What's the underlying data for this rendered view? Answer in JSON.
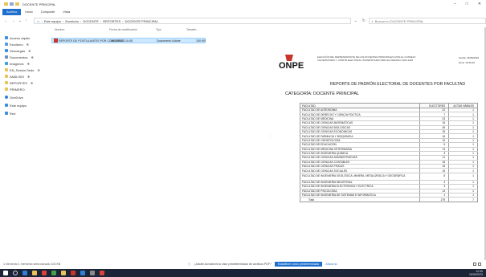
{
  "window": {
    "title": "DOCENTE PRINCIPAL",
    "controls": [
      "–",
      "□",
      "✕"
    ]
  },
  "ribbon": {
    "tabs": [
      "Archivo",
      "Inicio",
      "Compartir",
      "Vista"
    ]
  },
  "address": {
    "crumbs": [
      "Este equipo",
      "Escritorio",
      "DOCENTE",
      "REPORTES",
      "DOCENTE PRINCIPAL"
    ],
    "search_placeholder": "Buscar en DOCENTE PRINCIPAL"
  },
  "sidebar": {
    "items": [
      {
        "label": "Acceso rápido",
        "color": "#3b8fe0",
        "pinned": false
      },
      {
        "label": "Escritorio",
        "color": "#4f9be6",
        "pinned": true
      },
      {
        "label": "Descargas",
        "color": "#3b8fe0",
        "pinned": true
      },
      {
        "label": "Documentos",
        "color": "#6a8fb8",
        "pinned": true
      },
      {
        "label": "Imágenes",
        "color": "#3f9fd8",
        "pinned": true
      },
      {
        "label": "EN_Sesión Sede",
        "color": "#e8c45a",
        "pinned": true
      },
      {
        "label": "ANÁLISIS",
        "color": "#e8c45a",
        "pinned": true
      },
      {
        "label": "REPORTES",
        "color": "#e8c45a",
        "pinned": true
      },
      {
        "label": "PRIMERO",
        "color": "#e8c45a",
        "pinned": false
      },
      {
        "label": "OneDrive",
        "color": "#2f7fd6",
        "pinned": false
      },
      {
        "label": "Este equipo",
        "color": "#3b8fe0",
        "pinned": false,
        "active": true
      },
      {
        "label": "Red",
        "color": "#3b8fe0",
        "pinned": false
      }
    ]
  },
  "filelist": {
    "columns": [
      "Nombre",
      "Fecha de modificación",
      "Tipo",
      "Tamaño"
    ],
    "files": [
      {
        "name": "REPORTE DE POSTULANTES POR CONCURSO",
        "date": "15/05/2023 10:45",
        "type": "Documento Adobe",
        "size": "100 KB"
      }
    ]
  },
  "preview": {
    "logo_text": "ONPE",
    "header_lines": [
      "ELECCIÓN DEL REPRESENTANTE DE LOS DOCENTES PRINCIPALES ANTE EL CONSEJO",
      "UNIVERSITARIO Y COMITÉ ELECTORAL UNIVERSITARIO PARA EL PERIODO 2023-2025"
    ],
    "meta": [
      {
        "label": "Fecha:",
        "value": "15/05/2023"
      },
      {
        "label": "Hora:",
        "value": "10:45:45"
      }
    ],
    "report_title": "REPORTE DE PADRÓN ELECTORAL DE DOCENTES POR FACULTAD",
    "category": "CATEGORÍA: DOCENTE PRINCIPAL",
    "table": {
      "headers": [
        "FACULTAD",
        "ELECTORES",
        "ACTAS HÁBILES"
      ],
      "rows": [
        [
          "FACULTAD DE AGRONOMÍA",
          "22",
          "1"
        ],
        [
          "FACULTAD DE DERECHO Y CIENCIA POLÍTICA",
          "7",
          "1"
        ],
        [
          "FACULTAD DE MEDICINA",
          "23",
          "1"
        ],
        [
          "FACULTAD DE CIENCIAS MATEMÁTICAS",
          "15",
          "1"
        ],
        [
          "FACULTAD DE CIENCIAS BIOLÓGICAS",
          "45",
          "1"
        ],
        [
          "FACULTAD DE CIENCIAS ECONÓMICAS",
          "15",
          "1"
        ],
        [
          "FACULTAD DE FARMACIA Y BIOQUÍMICA",
          "16",
          "1"
        ],
        [
          "FACULTAD DE ODONTOLOGÍA",
          "10",
          "1"
        ],
        [
          "FACULTAD DE EDUCACIÓN",
          "5",
          "1"
        ],
        [
          "FACULTAD DE MEDICINA VETERINARIA",
          "13",
          "1"
        ],
        [
          "FACULTAD DE INGENIERÍA QUÍMICA",
          "3",
          "1"
        ],
        [
          "FACULTAD DE CIENCIAS ADMINISTRATIVAS",
          "11",
          "1"
        ],
        [
          "FACULTAD DE CIENCIAS CONTABLES",
          "18",
          "1"
        ],
        [
          "FACULTAD DE CIENCIAS FÍSICAS",
          "16",
          "1"
        ],
        [
          "FACULTAD DE CIENCIAS SOCIALES",
          "15",
          "1"
        ],
        [
          "FACULTAD DE INGENIERÍA GEOLÓGICA, MINERA, METALÚRGICA Y GEOGRÁFICA",
          "8",
          "1"
        ],
        [
          "FACULTAD DE INGENIERÍA INDUSTRIAL",
          "3",
          "1"
        ],
        [
          "FACULTAD DE INGENIERÍA ELECTRÓNICA Y ELÉCTRICA",
          "3",
          "1"
        ],
        [
          "FACULTAD DE PSICOLOGÍA",
          "14",
          "1"
        ],
        [
          "FACULTAD DE INGENIERÍA DE SISTEMAS E INFORMÁTICA",
          "1",
          "1"
        ]
      ],
      "total_label": "Total",
      "total_electores": "279",
      "total_actas": "7"
    }
  },
  "statusbar": {
    "left": "1 elemento   1 elemento seleccionado 100 KB",
    "notif_text": "¿Adobe Acrobat es tu visor predeterminado de archivos PDF?",
    "notif_primary": "Establecer como predeterminado",
    "notif_link": "Ahora no"
  },
  "taskbar": {
    "time": "10:46",
    "date": "15/05/2023",
    "icon_colors": [
      "#2f7fd6",
      "#e8c45a",
      "#d8423a",
      "#3fa34d",
      "#e8c45a",
      "#c8352b",
      "#2f7fd6",
      "#8a8a8a",
      "#d8423a"
    ]
  }
}
